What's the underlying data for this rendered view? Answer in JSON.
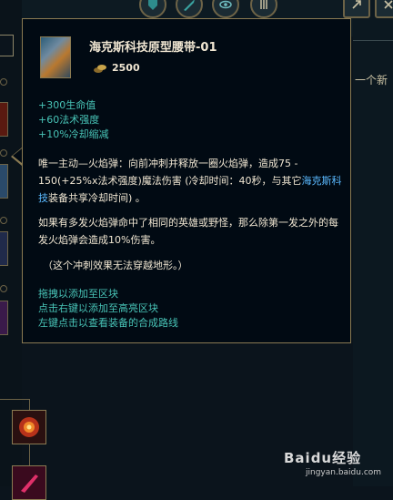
{
  "tooltip": {
    "item_name": "海克斯科技原型腰带-01",
    "gold": "2500",
    "stats": [
      "+300生命值",
      "+60法术强度",
      "+10%冷却缩减"
    ],
    "passive": {
      "label": "唯一主动—火焰弹",
      "text_a": "：向前冲刺并释放一圈火焰弹，造成75 - 150(+25%x法术强度)魔法伤害 (冷却时间：40秒，与其它",
      "link": "海克斯科技",
      "text_b": "装备共享冷却时间) 。"
    },
    "paragraph2": "如果有多发火焰弹命中了相同的英雄或野怪，那么除第一发之外的每发火焰弹会造成10%伤害。",
    "paragraph3": "（这个冲刺效果无法穿越地形。）",
    "hints": [
      "拖拽以添加至区块",
      "点击右键以添加至高亮区块",
      "左键点击以查看装备的合成路线"
    ]
  },
  "background": {
    "right_text": "一个新"
  },
  "watermark": {
    "brand": "Baidu经验",
    "url": "jingyan.baidu.com"
  },
  "colors": {
    "tooltip_bg": "#010a13",
    "border_gold": "#8a7a52",
    "stat_teal": "#48c4b7",
    "text_cream": "#f0e6d2",
    "link_blue": "#5ab9ff"
  },
  "icons": [
    "shield-icon",
    "blade-icon",
    "eye-icon",
    "settings-icon",
    "share-icon",
    "close-icon",
    "coin-icon"
  ]
}
